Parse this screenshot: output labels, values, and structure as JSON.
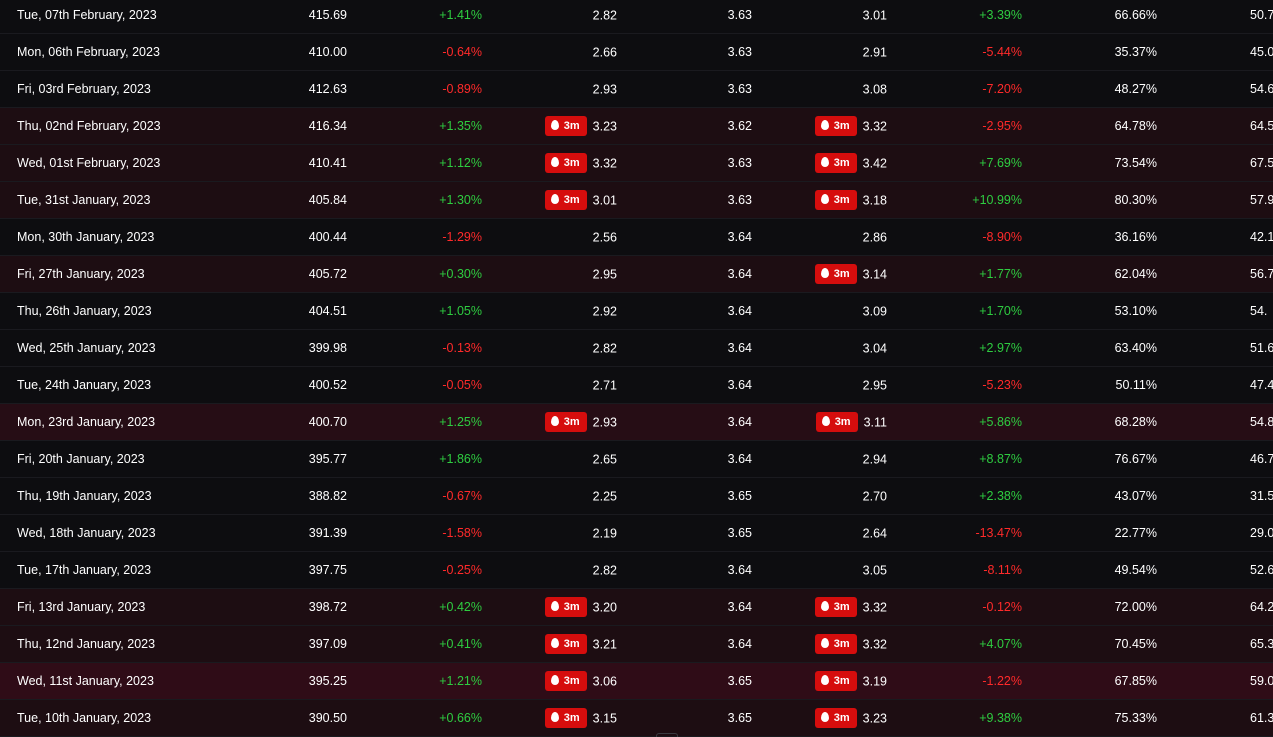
{
  "colors": {
    "background": "#0d0d10",
    "positive": "#2ecc40",
    "negative": "#ff2a2a",
    "badge": "#d60d0d",
    "highlight_row": "#260d15"
  },
  "badge_icon": "flame-icon",
  "rows": [
    {
      "date": "Tue, 07th February, 2023",
      "close": "415.69",
      "change": "+1.41%",
      "v1": "2.82",
      "v1_badge": "",
      "v2": "3.63",
      "v3": "3.01",
      "v3_badge": "",
      "change2": "+3.39%",
      "pct": "66.66%",
      "last": "50.7"
    },
    {
      "date": "Mon, 06th February, 2023",
      "close": "410.00",
      "change": "-0.64%",
      "v1": "2.66",
      "v1_badge": "",
      "v2": "3.63",
      "v3": "2.91",
      "v3_badge": "",
      "change2": "-5.44%",
      "pct": "35.37%",
      "last": "45.0"
    },
    {
      "date": "Fri, 03rd February, 2023",
      "close": "412.63",
      "change": "-0.89%",
      "v1": "2.93",
      "v1_badge": "",
      "v2": "3.63",
      "v3": "3.08",
      "v3_badge": "",
      "change2": "-7.20%",
      "pct": "48.27%",
      "last": "54.6"
    },
    {
      "date": "Thu, 02nd February, 2023",
      "close": "416.34",
      "change": "+1.35%",
      "v1": "3.23",
      "v1_badge": "3m",
      "v2": "3.62",
      "v3": "3.32",
      "v3_badge": "3m",
      "change2": "-2.95%",
      "pct": "64.78%",
      "last": "64.5"
    },
    {
      "date": "Wed, 01st February, 2023",
      "close": "410.41",
      "change": "+1.12%",
      "v1": "3.32",
      "v1_badge": "3m",
      "v2": "3.63",
      "v3": "3.42",
      "v3_badge": "3m",
      "change2": "+7.69%",
      "pct": "73.54%",
      "last": "67.5"
    },
    {
      "date": "Tue, 31st January, 2023",
      "close": "405.84",
      "change": "+1.30%",
      "v1": "3.01",
      "v1_badge": "3m",
      "v2": "3.63",
      "v3": "3.18",
      "v3_badge": "3m",
      "change2": "+10.99%",
      "pct": "80.30%",
      "last": "57.9"
    },
    {
      "date": "Mon, 30th January, 2023",
      "close": "400.44",
      "change": "-1.29%",
      "v1": "2.56",
      "v1_badge": "",
      "v2": "3.64",
      "v3": "2.86",
      "v3_badge": "",
      "change2": "-8.90%",
      "pct": "36.16%",
      "last": "42.1"
    },
    {
      "date": "Fri, 27th January, 2023",
      "close": "405.72",
      "change": "+0.30%",
      "v1": "2.95",
      "v1_badge": "",
      "v2": "3.64",
      "v3": "3.14",
      "v3_badge": "3m",
      "change2": "+1.77%",
      "pct": "62.04%",
      "last": "56.7"
    },
    {
      "date": "Thu, 26th January, 2023",
      "close": "404.51",
      "change": "+1.05%",
      "v1": "2.92",
      "v1_badge": "",
      "v2": "3.64",
      "v3": "3.09",
      "v3_badge": "",
      "change2": "+1.70%",
      "pct": "53.10%",
      "last": "54."
    },
    {
      "date": "Wed, 25th January, 2023",
      "close": "399.98",
      "change": "-0.13%",
      "v1": "2.82",
      "v1_badge": "",
      "v2": "3.64",
      "v3": "3.04",
      "v3_badge": "",
      "change2": "+2.97%",
      "pct": "63.40%",
      "last": "51.6"
    },
    {
      "date": "Tue, 24th January, 2023",
      "close": "400.52",
      "change": "-0.05%",
      "v1": "2.71",
      "v1_badge": "",
      "v2": "3.64",
      "v3": "2.95",
      "v3_badge": "",
      "change2": "-5.23%",
      "pct": "50.11%",
      "last": "47.4"
    },
    {
      "date": "Mon, 23rd January, 2023",
      "close": "400.70",
      "change": "+1.25%",
      "v1": "2.93",
      "v1_badge": "3m",
      "v2": "3.64",
      "v3": "3.11",
      "v3_badge": "3m",
      "change2": "+5.86%",
      "pct": "68.28%",
      "last": "54.8"
    },
    {
      "date": "Fri, 20th January, 2023",
      "close": "395.77",
      "change": "+1.86%",
      "v1": "2.65",
      "v1_badge": "",
      "v2": "3.64",
      "v3": "2.94",
      "v3_badge": "",
      "change2": "+8.87%",
      "pct": "76.67%",
      "last": "46.7"
    },
    {
      "date": "Thu, 19th January, 2023",
      "close": "388.82",
      "change": "-0.67%",
      "v1": "2.25",
      "v1_badge": "",
      "v2": "3.65",
      "v3": "2.70",
      "v3_badge": "",
      "change2": "+2.38%",
      "pct": "43.07%",
      "last": "31.5"
    },
    {
      "date": "Wed, 18th January, 2023",
      "close": "391.39",
      "change": "-1.58%",
      "v1": "2.19",
      "v1_badge": "",
      "v2": "3.65",
      "v3": "2.64",
      "v3_badge": "",
      "change2": "-13.47%",
      "pct": "22.77%",
      "last": "29.0"
    },
    {
      "date": "Tue, 17th January, 2023",
      "close": "397.75",
      "change": "-0.25%",
      "v1": "2.82",
      "v1_badge": "",
      "v2": "3.64",
      "v3": "3.05",
      "v3_badge": "",
      "change2": "-8.11%",
      "pct": "49.54%",
      "last": "52.6"
    },
    {
      "date": "Fri, 13rd January, 2023",
      "close": "398.72",
      "change": "+0.42%",
      "v1": "3.20",
      "v1_badge": "3m",
      "v2": "3.64",
      "v3": "3.32",
      "v3_badge": "3m",
      "change2": "-0.12%",
      "pct": "72.00%",
      "last": "64.2"
    },
    {
      "date": "Thu, 12nd January, 2023",
      "close": "397.09",
      "change": "+0.41%",
      "v1": "3.21",
      "v1_badge": "3m",
      "v2": "3.64",
      "v3": "3.32",
      "v3_badge": "3m",
      "change2": "+4.07%",
      "pct": "70.45%",
      "last": "65.3"
    },
    {
      "date": "Wed, 11st January, 2023",
      "close": "395.25",
      "change": "+1.21%",
      "v1": "3.06",
      "v1_badge": "3m",
      "v2": "3.65",
      "v3": "3.19",
      "v3_badge": "3m",
      "change2": "-1.22%",
      "pct": "67.85%",
      "last": "59.0"
    },
    {
      "date": "Tue, 10th January, 2023",
      "close": "390.50",
      "change": "+0.66%",
      "v1": "3.15",
      "v1_badge": "3m",
      "v2": "3.65",
      "v3": "3.23",
      "v3_badge": "3m",
      "change2": "+9.38%",
      "pct": "75.33%",
      "last": "61.3"
    }
  ]
}
